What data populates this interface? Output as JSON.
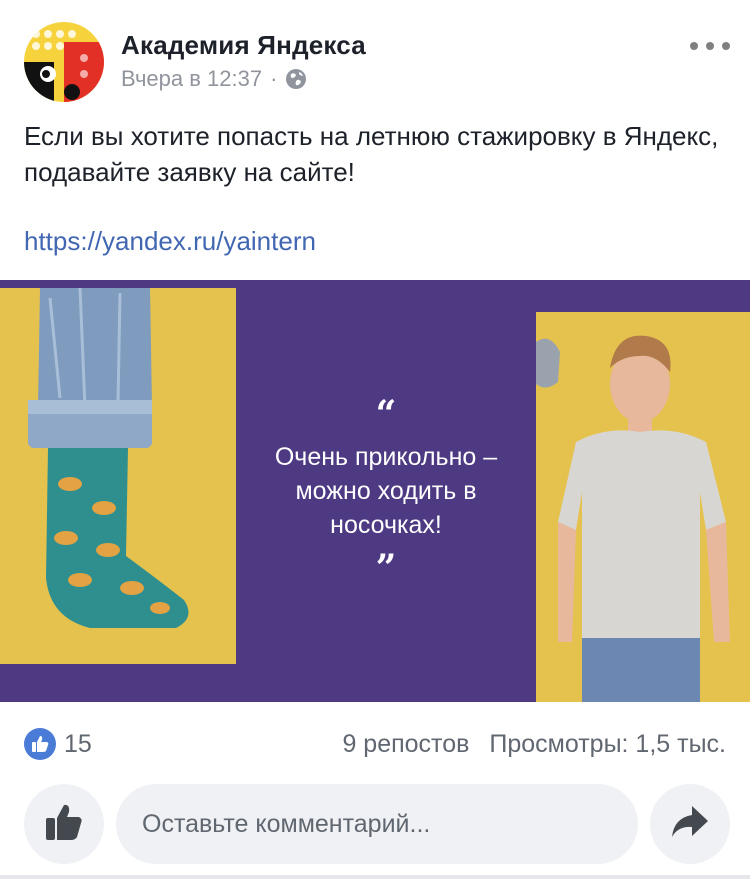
{
  "post": {
    "page_name": "Академия Яндекса",
    "time": "Вчера в 12:37",
    "separator": "·",
    "privacy_icon": "globe-icon",
    "more_icon": "more-dots-icon",
    "text": "Если вы хотите попасть на летнюю стажировку в Яндекс, подавайте заявку на сайте!",
    "link": "https://yandex.ru/yaintern"
  },
  "image": {
    "quote_open": "“",
    "quote_text": "Очень прикольно – можно ходить в носочках!",
    "quote_close": "”",
    "colors": {
      "purple": "#4d3a82",
      "yellow": "#e5c24d",
      "sock": "#2f8f8f"
    }
  },
  "stats": {
    "like_icon": "thumbs-up-icon",
    "likes": "15",
    "reposts": "9 репостов",
    "views": "Просмотры: 1,5 тыс."
  },
  "actions": {
    "like_icon": "thumbs-up-icon",
    "comment_placeholder": "Оставьте комментарий...",
    "share_icon": "share-arrow-icon"
  }
}
